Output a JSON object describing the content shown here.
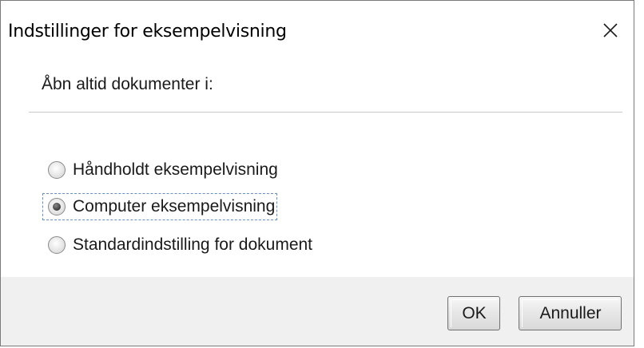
{
  "window": {
    "title": "Indstillinger for eksempelvisning",
    "close_icon": "close-icon"
  },
  "main": {
    "heading": "Åbn altid dokumenter i:",
    "options": [
      {
        "label": "Håndholdt eksempelvisning",
        "selected": false
      },
      {
        "label": "Computer eksempelvisning",
        "selected": true,
        "focused": true
      },
      {
        "label": "Standardindstilling for dokument",
        "selected": false
      }
    ]
  },
  "footer": {
    "ok_label": "OK",
    "cancel_label": "Annuller"
  },
  "colors": {
    "footer_bg": "#f0f0f0",
    "focus_outline": "#6a8fbf"
  }
}
